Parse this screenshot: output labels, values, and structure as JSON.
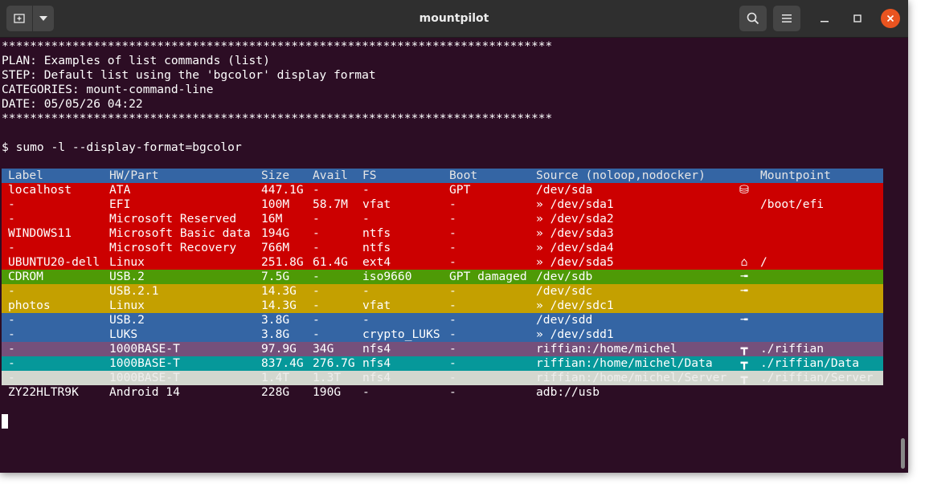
{
  "window": {
    "title": "mountpilot"
  },
  "icons": {
    "new_tab": "new-tab-icon",
    "dropdown": "chevron-down-icon",
    "search": "search-icon",
    "menu": "hamburger-menu-icon",
    "minimize": "minimize-icon",
    "maximize": "maximize-icon",
    "close": "close-icon"
  },
  "colors": {
    "terminal_bg": "#2c0d24",
    "header": "#3465a4",
    "red": "#cc0000",
    "green": "#4e9a06",
    "yellow": "#c4a000",
    "blue": "#3465a4",
    "purple": "#75507b",
    "cyan": "#06989a",
    "white": "#d3d7cf",
    "close_button": "#e95420"
  },
  "terminal": {
    "stars": "******************************************************************************",
    "plan": "PLAN: Examples of list commands (list)",
    "step": "STEP: Default list using the 'bgcolor' display format",
    "categories": "CATEGORIES: mount-command-line",
    "date": "DATE: 05/05/26 04:22",
    "command": "$ sumo -l --display-format=bgcolor"
  },
  "table": {
    "headers": [
      "Label",
      "HW/Part",
      "Size",
      "Avail",
      "FS",
      "Boot",
      "Source (noloop,nodocker)",
      "",
      "Mountpoint"
    ],
    "rows": [
      {
        "color": "red",
        "cells": [
          "localhost",
          "ATA",
          "447.1G",
          "-",
          "-",
          "GPT",
          "/dev/sda",
          "⛁",
          ""
        ]
      },
      {
        "color": "red",
        "cells": [
          "-",
          "EFI",
          "100M",
          "58.7M",
          "vfat",
          "-",
          "» /dev/sda1",
          "",
          "/boot/efi"
        ]
      },
      {
        "color": "red",
        "cells": [
          "-",
          "Microsoft Reserved",
          "16M",
          "-",
          "-",
          "-",
          "» /dev/sda2",
          "",
          ""
        ]
      },
      {
        "color": "red",
        "cells": [
          "WINDOWS11",
          "Microsoft Basic data",
          "194G",
          "-",
          "ntfs",
          "-",
          "» /dev/sda3",
          "",
          ""
        ]
      },
      {
        "color": "red",
        "cells": [
          "-",
          "Microsoft Recovery",
          "766M",
          "-",
          "ntfs",
          "-",
          "» /dev/sda4",
          "",
          ""
        ]
      },
      {
        "color": "red",
        "cells": [
          "UBUNTU20-dell",
          "Linux",
          "251.8G",
          "61.4G",
          "ext4",
          "-",
          "» /dev/sda5",
          "⌂",
          "/"
        ]
      },
      {
        "color": "green",
        "cells": [
          "CDROM",
          "USB.2",
          "7.5G",
          "-",
          "iso9660",
          "GPT damaged",
          "/dev/sdb",
          "╼",
          ""
        ]
      },
      {
        "color": "yellow",
        "cells": [
          "-",
          "USB.2.1",
          "14.3G",
          "-",
          "-",
          "-",
          "/dev/sdc",
          "╼",
          ""
        ]
      },
      {
        "color": "yellow",
        "cells": [
          "photos",
          "Linux",
          "14.3G",
          "-",
          "vfat",
          "-",
          "» /dev/sdc1",
          "",
          ""
        ]
      },
      {
        "color": "blue",
        "cells": [
          "-",
          "USB.2",
          "3.8G",
          "-",
          "-",
          "-",
          "/dev/sdd",
          "╼",
          ""
        ]
      },
      {
        "color": "blue",
        "cells": [
          "-",
          "LUKS",
          "3.8G",
          "-",
          "crypto_LUKS",
          "-",
          "» /dev/sdd1",
          "",
          ""
        ]
      },
      {
        "color": "purple",
        "cells": [
          "-",
          "1000BASE-T",
          "97.9G",
          "34G",
          "nfs4",
          "-",
          "riffian:/home/michel",
          "┳",
          "./riffian"
        ]
      },
      {
        "color": "cyan",
        "cells": [
          "-",
          "1000BASE-T",
          "837.4G",
          "276.7G",
          "nfs4",
          "-",
          "riffian:/home/michel/Data",
          "┳",
          "./riffian/Data"
        ]
      },
      {
        "color": "white",
        "cells": [
          "-",
          "1000BASE-T",
          "1.4T",
          "1.3T",
          "nfs4",
          "-",
          "riffian:/home/michel/Server",
          "┳",
          "./riffian/Server"
        ]
      },
      {
        "color": "plain",
        "cells": [
          "ZY22HLTR9K",
          "Android 14",
          "228G",
          "190G",
          "-",
          "-",
          "adb://usb",
          "",
          ""
        ]
      }
    ]
  }
}
